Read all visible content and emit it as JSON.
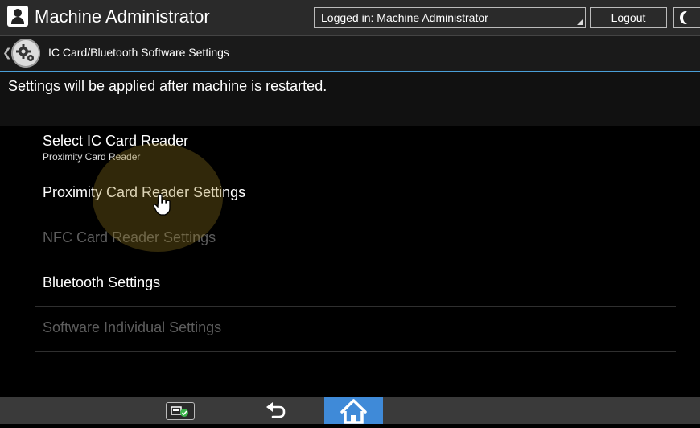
{
  "header": {
    "title": "Machine Administrator",
    "logged_in": "Logged in: Machine Administrator",
    "logout_label": "Logout"
  },
  "breadcrumb": {
    "label": "IC Card/Bluetooth Software Settings",
    "icon": "gear-icon"
  },
  "notice": "Settings will be applied after machine is restarted.",
  "settings_list": [
    {
      "label": "Select IC Card Reader",
      "sub": "Proximity Card Reader",
      "enabled": true
    },
    {
      "label": "Proximity Card Reader Settings",
      "enabled": true
    },
    {
      "label": "NFC Card Reader Settings",
      "enabled": false
    },
    {
      "label": "Bluetooth Settings",
      "enabled": true
    },
    {
      "label": "Software Individual Settings",
      "enabled": false
    }
  ],
  "bottom_bar": {
    "icons": [
      "card-status-icon",
      "back-arrow-icon",
      "home-icon"
    ]
  },
  "colors": {
    "accent": "#3f8ad8",
    "divider_blue": "#4a9fd8",
    "disabled_text": "#5d5d5d"
  }
}
